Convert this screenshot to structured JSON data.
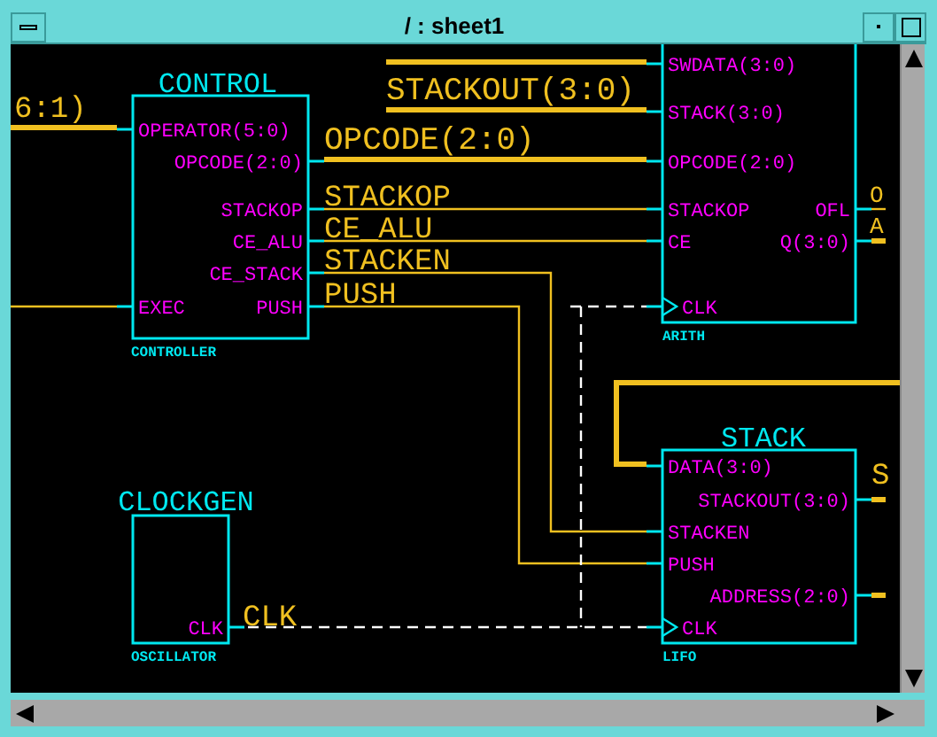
{
  "window": {
    "title": "/ : sheet1"
  },
  "symbols": [
    {
      "title": "CONTROL",
      "type": "CONTROLLER",
      "left_pins": [
        {
          "label": "OPERATOR(5:0)",
          "clock": false
        },
        {
          "label": "EXEC",
          "clock": false
        }
      ],
      "right_pins": [
        {
          "label": "OPCODE(2:0)"
        },
        {
          "label": "STACKOP"
        },
        {
          "label": "CE_ALU"
        },
        {
          "label": "CE_STACK"
        },
        {
          "label": "PUSH"
        }
      ]
    },
    {
      "type": "ARITH",
      "left_pins": [
        {
          "label": "SWDATA(3:0)",
          "clock": false
        },
        {
          "label": "STACK(3:0)",
          "clock": false
        },
        {
          "label": "OPCODE(2:0)",
          "clock": false
        },
        {
          "label": "STACKOP",
          "clock": false
        },
        {
          "label": "CE",
          "clock": false
        },
        {
          "label": "CLK",
          "clock": true
        }
      ],
      "right_pins": [
        {
          "label": "OFL"
        },
        {
          "label": "Q(3:0)"
        }
      ]
    },
    {
      "title": "CLOCKGEN",
      "type": "OSCILLATOR",
      "right_pins": [
        {
          "label": "CLK"
        }
      ]
    },
    {
      "title": "STACK",
      "type": "LIFO",
      "left_pins": [
        {
          "label": "DATA(3:0)",
          "clock": false
        },
        {
          "label": "STACKEN",
          "clock": false
        },
        {
          "label": "PUSH",
          "clock": false
        },
        {
          "label": "CLK",
          "clock": true
        }
      ],
      "right_pins": [
        {
          "label": "STACKOUT(3:0)"
        },
        {
          "label": "ADDRESS(2:0)"
        }
      ]
    }
  ],
  "net_labels": [
    "6:1)",
    "STACKOUT(3:0)",
    "OPCODE(2:0)",
    "STACKOP",
    "CE_ALU",
    "STACKEN",
    "PUSH",
    "O",
    "A",
    "S",
    "CLK"
  ]
}
